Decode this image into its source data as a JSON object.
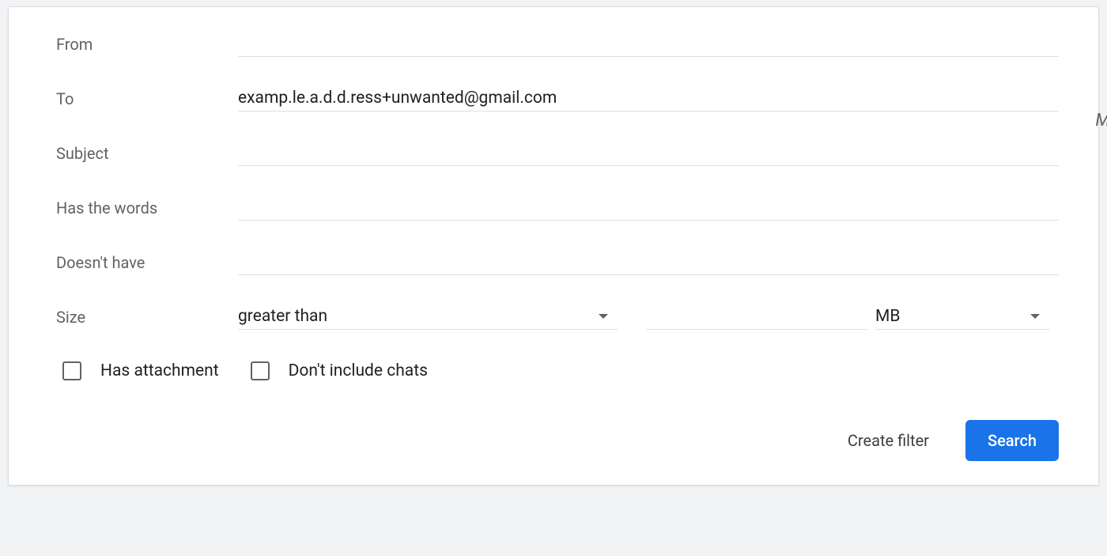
{
  "fields": {
    "from": {
      "label": "From",
      "value": ""
    },
    "to": {
      "label": "To",
      "value": "examp.le.a.d.d.ress+unwanted@gmail.com"
    },
    "subject": {
      "label": "Subject",
      "value": ""
    },
    "has_words": {
      "label": "Has the words",
      "value": ""
    },
    "doesnt_have": {
      "label": "Doesn't have",
      "value": ""
    }
  },
  "size": {
    "label": "Size",
    "comparator": "greater than",
    "value": "",
    "unit": "MB"
  },
  "checkboxes": {
    "has_attachment": {
      "label": "Has attachment",
      "checked": false
    },
    "dont_include_chats": {
      "label": "Don't include chats",
      "checked": false
    }
  },
  "buttons": {
    "create_filter": "Create filter",
    "search": "Search"
  },
  "background_hint": "M"
}
